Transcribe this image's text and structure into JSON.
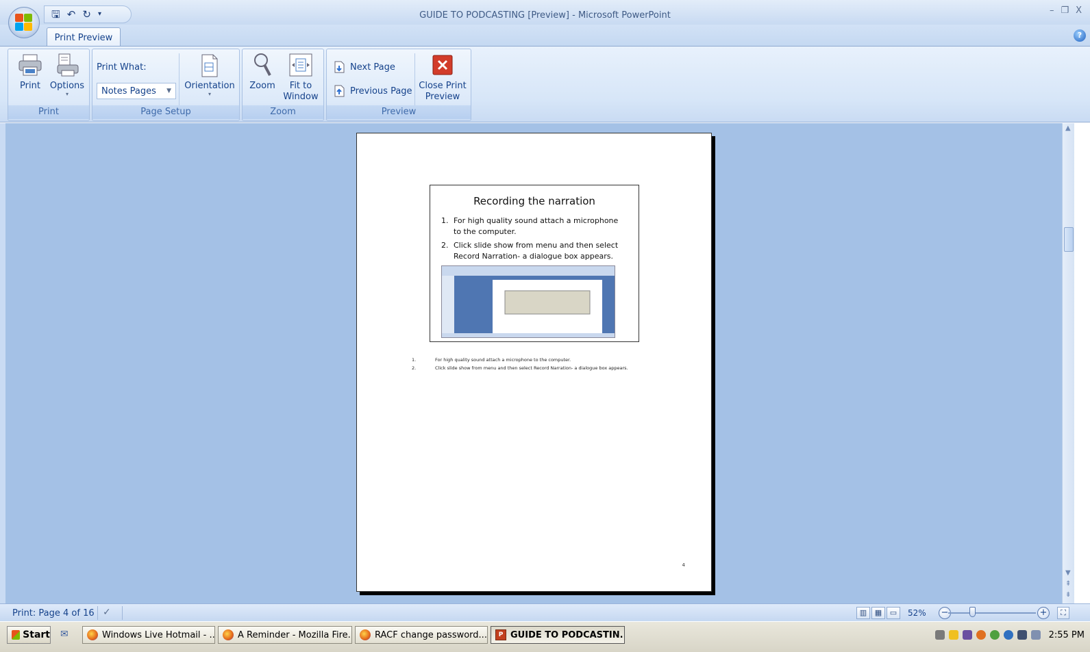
{
  "window": {
    "title": "GUIDE TO PODCASTING [Preview] - Microsoft PowerPoint",
    "minimize": "–",
    "restore": "❐",
    "close": "X"
  },
  "quick_access": {
    "icons": [
      "save-icon",
      "undo-icon",
      "redo-icon",
      "customize-icon"
    ]
  },
  "tabs": [
    {
      "label": "Print Preview"
    }
  ],
  "ribbon": {
    "print_group": {
      "label": "Print",
      "print": "Print",
      "options": "Options"
    },
    "page_setup_group": {
      "label": "Page Setup",
      "print_what_label": "Print What:",
      "print_what_value": "Notes Pages",
      "orientation": "Orientation"
    },
    "zoom_group": {
      "label": "Zoom",
      "zoom": "Zoom",
      "fit_line1": "Fit to",
      "fit_line2": "Window"
    },
    "preview_group": {
      "label": "Preview",
      "next_page": "Next Page",
      "previous_page": "Previous Page",
      "close_line1": "Close Print",
      "close_line2": "Preview"
    }
  },
  "page": {
    "slide_title": "Recording the narration",
    "bullets": [
      {
        "num": "1.",
        "text": "For high quality sound attach a microphone to the computer."
      },
      {
        "num": "2.",
        "text": "Click slide show from menu and then select Record Narration- a dialogue box appears."
      }
    ],
    "notes": [
      {
        "num": "1.",
        "text": "For high quality sound attach a microphone  to the computer."
      },
      {
        "num": "2.",
        "text": "Click slide show  from menu  and then select  Record Narration- a dialogue box appears."
      }
    ],
    "page_number": "4"
  },
  "status": {
    "page_info": "Print: Page 4 of 16",
    "zoom_percent": "52%",
    "zoom_minus": "−",
    "zoom_plus": "+"
  },
  "taskbar": {
    "start": "Start",
    "tasks": [
      {
        "label": "Windows Live Hotmail - ..."
      },
      {
        "label": "A Reminder - Mozilla Fire..."
      },
      {
        "label": "RACF change password...."
      },
      {
        "label": "GUIDE TO PODCASTIN..."
      }
    ],
    "clock": "2:55 PM"
  },
  "colors": {
    "workspace": "#a4c1e6",
    "ribbon_text": "#15428b",
    "close_red": "#d23c2a"
  }
}
